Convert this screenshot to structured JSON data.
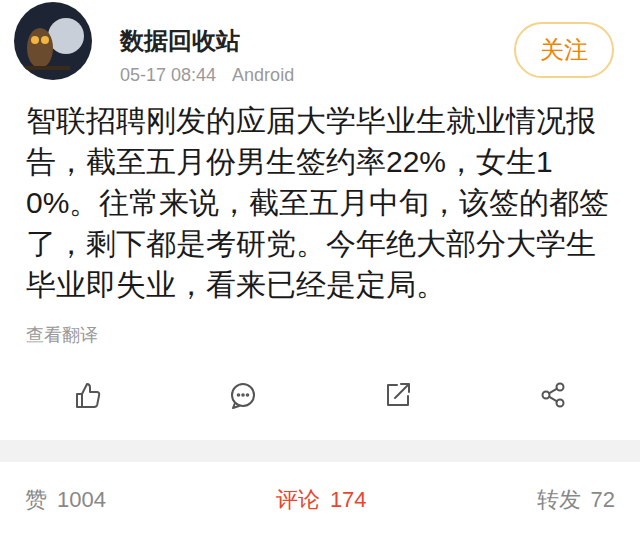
{
  "user": {
    "name": "数据回收站",
    "time": "05-17 08:44",
    "device": "Android"
  },
  "follow_button": "关注",
  "post": {
    "text": "智联招聘刚发的应届大学毕业生就业情况报告，截至五月份男生签约率22%，女生10%。往常来说，截至五月中旬，该签的都签了，剩下都是考研党。今年绝大部分大学生毕业即失业，看来已经是定局。",
    "translate": "查看翻译"
  },
  "stats": [
    {
      "label": "赞",
      "count": "1004",
      "selected": false
    },
    {
      "label": "评论",
      "count": "174",
      "selected": true
    },
    {
      "label": "转发",
      "count": "72",
      "selected": false
    }
  ]
}
